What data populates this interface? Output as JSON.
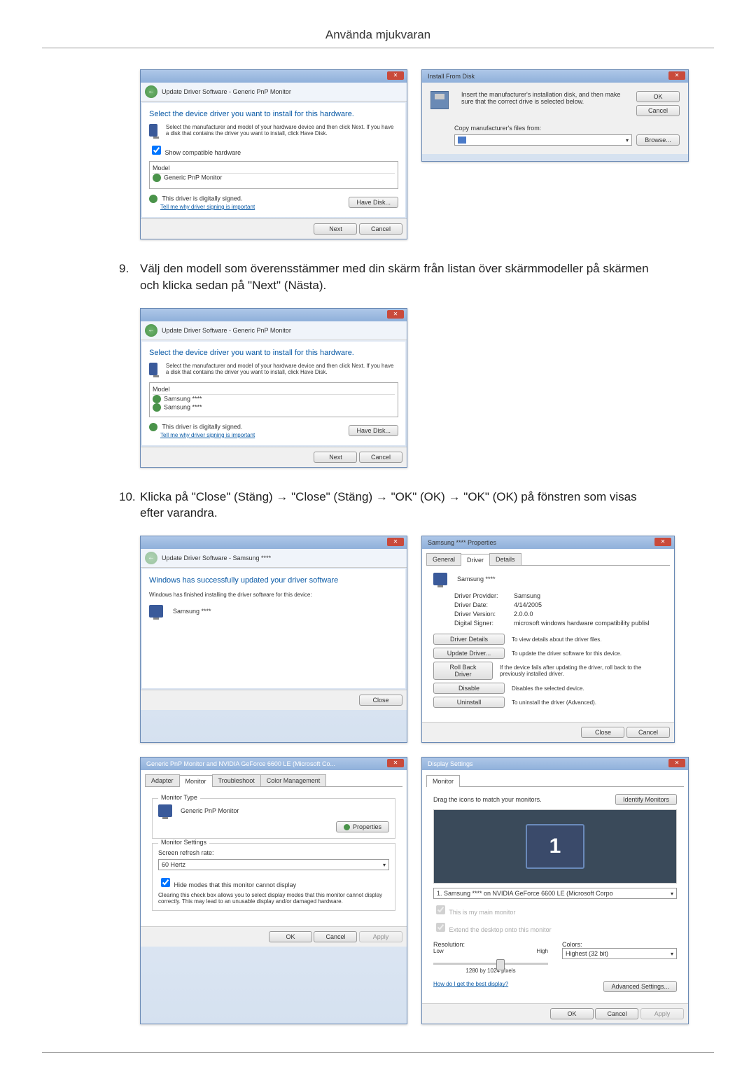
{
  "header": {
    "title": "Använda mjukvaran"
  },
  "steps": {
    "s9": {
      "num": "9.",
      "text": "Välj den modell som överensstämmer med din skärm från listan över skärmmodeller på skärmen och klicka sedan på \"Next\" (Nästa)."
    },
    "s10": {
      "num": "10.",
      "text": "Klicka på \"Close\" (Stäng) → \"Close\" (Stäng) → \"OK\" (OK) → \"OK\" (OK) på fönstren som visas efter varandra."
    }
  },
  "dlg1": {
    "crumb": "Update Driver Software - Generic PnP Monitor",
    "heading": "Select the device driver you want to install for this hardware.",
    "instr": "Select the manufacturer and model of your hardware device and then click Next. If you have a disk that contains the driver you want to install, click Have Disk.",
    "checkbox": "Show compatible hardware",
    "model_hdr": "Model",
    "model_item": "Generic PnP Monitor",
    "signed": "This driver is digitally signed.",
    "tell": "Tell me why driver signing is important",
    "have_disk": "Have Disk...",
    "next": "Next",
    "cancel": "Cancel"
  },
  "dlg2": {
    "title": "Install From Disk",
    "instr": "Insert the manufacturer's installation disk, and then make sure that the correct drive is selected below.",
    "ok": "OK",
    "cancel": "Cancel",
    "copy": "Copy manufacturer's files from:",
    "browse": "Browse..."
  },
  "dlg3": {
    "crumb": "Update Driver Software - Generic PnP Monitor",
    "heading": "Select the device driver you want to install for this hardware.",
    "instr": "Select the manufacturer and model of your hardware device and then click Next. If you have a disk that contains the driver you want to install, click Have Disk.",
    "model_hdr": "Model",
    "model1": "Samsung ****",
    "model2": "Samsung ****",
    "signed": "This driver is digitally signed.",
    "tell": "Tell me why driver signing is important",
    "have_disk": "Have Disk...",
    "next": "Next",
    "cancel": "Cancel"
  },
  "dlg4": {
    "crumb": "Update Driver Software - Samsung ****",
    "heading": "Windows has successfully updated your driver software",
    "sub": "Windows has finished installing the driver software for this device:",
    "device": "Samsung ****",
    "close": "Close"
  },
  "dlg5": {
    "title": "Samsung **** Properties",
    "tabs": {
      "general": "General",
      "driver": "Driver",
      "details": "Details"
    },
    "device": "Samsung ****",
    "provider_l": "Driver Provider:",
    "provider_v": "Samsung",
    "date_l": "Driver Date:",
    "date_v": "4/14/2005",
    "version_l": "Driver Version:",
    "version_v": "2.0.0.0",
    "signer_l": "Digital Signer:",
    "signer_v": "microsoft windows hardware compatibility publisl",
    "btns": {
      "details": "Driver Details",
      "details_d": "To view details about the driver files.",
      "update": "Update Driver...",
      "update_d": "To update the driver software for this device.",
      "rollback": "Roll Back Driver",
      "rollback_d": "If the device fails after updating the driver, roll back to the previously installed driver.",
      "disable": "Disable",
      "disable_d": "Disables the selected device.",
      "uninstall": "Uninstall",
      "uninstall_d": "To uninstall the driver (Advanced)."
    },
    "close": "Close",
    "cancel": "Cancel"
  },
  "dlg6": {
    "title": "Generic PnP Monitor and NVIDIA GeForce 6600 LE (Microsoft Co...",
    "tabs": {
      "adapter": "Adapter",
      "monitor": "Monitor",
      "trouble": "Troubleshoot",
      "color": "Color Management"
    },
    "type_grp": "Monitor Type",
    "type_val": "Generic PnP Monitor",
    "props": "Properties",
    "settings_grp": "Monitor Settings",
    "refresh": "Screen refresh rate:",
    "rate": "60 Hertz",
    "hide": "Hide modes that this monitor cannot display",
    "hide_desc": "Clearing this check box allows you to select display modes that this monitor cannot display correctly. This may lead to an unusable display and/or damaged hardware.",
    "ok": "OK",
    "cancel": "Cancel",
    "apply": "Apply"
  },
  "dlg7": {
    "title": "Display Settings",
    "tab": "Monitor",
    "drag": "Drag the icons to match your monitors.",
    "identify": "Identify Monitors",
    "num": "1",
    "sel": "1. Samsung **** on NVIDIA GeForce 6600 LE (Microsoft Corpo",
    "main": "This is my main monitor",
    "extend": "Extend the desktop onto this monitor",
    "res": "Resolution:",
    "low": "Low",
    "high": "High",
    "resval": "1280 by 1024 pixels",
    "colors": "Colors:",
    "colorval": "Highest (32 bit)",
    "howdo": "How do I get the best display?",
    "adv": "Advanced Settings...",
    "ok": "OK",
    "cancel": "Cancel",
    "apply": "Apply"
  }
}
